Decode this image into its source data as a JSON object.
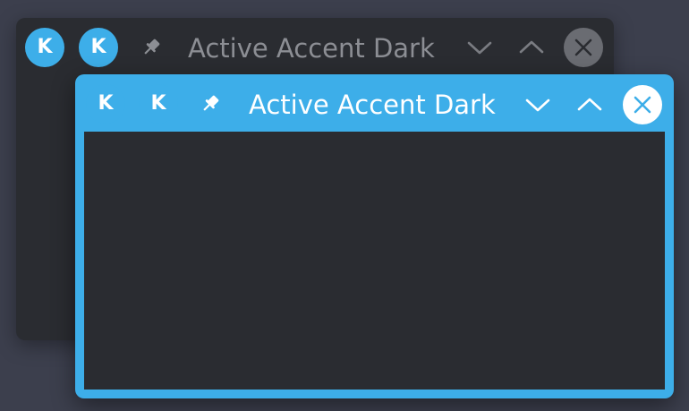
{
  "windows": [
    {
      "state": "inactive",
      "title": "Active Accent Dark",
      "icons": [
        "kde-app-icon",
        "kde-menu-icon",
        "pin-icon",
        "minimize-icon",
        "maximize-icon",
        "close-icon"
      ]
    },
    {
      "state": "active",
      "title": "Active Accent Dark",
      "icons": [
        "kde-app-icon",
        "kde-menu-icon",
        "pin-icon",
        "minimize-icon",
        "maximize-icon",
        "close-icon"
      ]
    }
  ],
  "colors": {
    "desktop_background": "#3c3f4d",
    "accent": "#3daee9",
    "window_content": "#2a2c31",
    "inactive_title_text": "#8c8e94",
    "active_title_text": "#ffffff",
    "inactive_close_circle": "#6a6c72"
  },
  "glyphs": {
    "kde_logo": "K"
  }
}
